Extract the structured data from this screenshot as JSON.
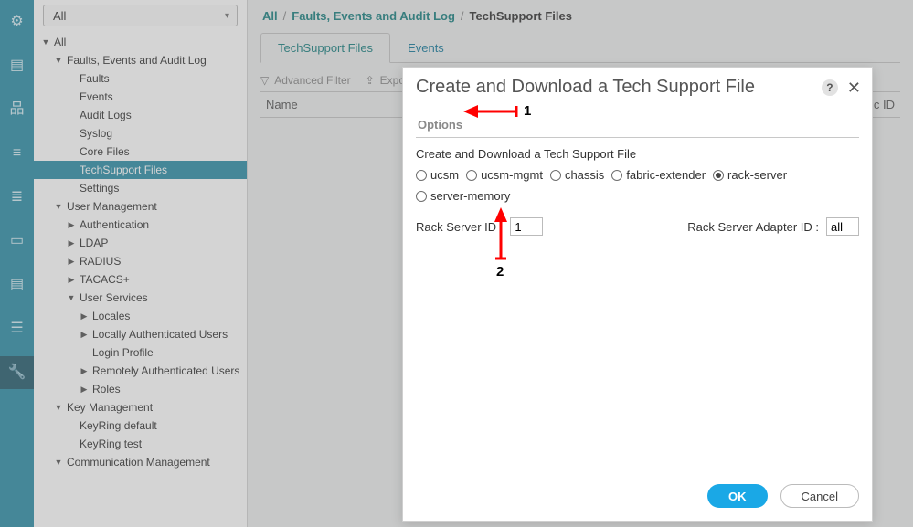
{
  "rail": {
    "items": [
      "network",
      "server",
      "topology",
      "stack",
      "rack",
      "monitor",
      "bars",
      "layers",
      "settings"
    ],
    "selected_index": 8
  },
  "nav": {
    "dropdown_value": "All",
    "tree": [
      {
        "lvl": 0,
        "label": "All",
        "arrow": "expanded"
      },
      {
        "lvl": 1,
        "label": "Faults, Events and Audit Log",
        "arrow": "expanded"
      },
      {
        "lvl": 2,
        "label": "Faults",
        "arrow": "none"
      },
      {
        "lvl": 2,
        "label": "Events",
        "arrow": "none"
      },
      {
        "lvl": 2,
        "label": "Audit Logs",
        "arrow": "none"
      },
      {
        "lvl": 2,
        "label": "Syslog",
        "arrow": "none"
      },
      {
        "lvl": 2,
        "label": "Core Files",
        "arrow": "none"
      },
      {
        "lvl": 2,
        "label": "TechSupport Files",
        "arrow": "none",
        "selected": true
      },
      {
        "lvl": 2,
        "label": "Settings",
        "arrow": "none"
      },
      {
        "lvl": 1,
        "label": "User Management",
        "arrow": "expanded"
      },
      {
        "lvl": 2,
        "label": "Authentication",
        "arrow": "collapsed"
      },
      {
        "lvl": 2,
        "label": "LDAP",
        "arrow": "collapsed"
      },
      {
        "lvl": 2,
        "label": "RADIUS",
        "arrow": "collapsed"
      },
      {
        "lvl": 2,
        "label": "TACACS+",
        "arrow": "collapsed"
      },
      {
        "lvl": 2,
        "label": "User Services",
        "arrow": "expanded"
      },
      {
        "lvl": 3,
        "label": "Locales",
        "arrow": "collapsed"
      },
      {
        "lvl": 3,
        "label": "Locally Authenticated Users",
        "arrow": "collapsed"
      },
      {
        "lvl": 3,
        "label": "Login Profile",
        "arrow": "none"
      },
      {
        "lvl": 3,
        "label": "Remotely Authenticated Users",
        "arrow": "collapsed"
      },
      {
        "lvl": 3,
        "label": "Roles",
        "arrow": "collapsed"
      },
      {
        "lvl": 1,
        "label": "Key Management",
        "arrow": "expanded"
      },
      {
        "lvl": 2,
        "label": "KeyRing default",
        "arrow": "none"
      },
      {
        "lvl": 2,
        "label": "KeyRing test",
        "arrow": "none"
      },
      {
        "lvl": 1,
        "label": "Communication Management",
        "arrow": "expanded"
      }
    ]
  },
  "breadcrumb": [
    {
      "label": "All"
    },
    {
      "label": "Faults, Events and Audit Log"
    },
    {
      "label": "TechSupport Files",
      "current": true
    }
  ],
  "tabs": [
    {
      "label": "TechSupport Files",
      "active": true
    },
    {
      "label": "Events",
      "active": false
    }
  ],
  "toolbar": {
    "filter_label": "Advanced Filter",
    "export_label": "Export"
  },
  "columns": {
    "name": "Name",
    "right": "ric ID"
  },
  "modal": {
    "title": "Create and Download a Tech Support File",
    "options_label": "Options",
    "subtitle": "Create and Download a Tech Support File",
    "radios": [
      {
        "label": "ucsm",
        "value": "ucsm",
        "checked": false
      },
      {
        "label": "ucsm-mgmt",
        "value": "ucsm-mgmt",
        "checked": false
      },
      {
        "label": "chassis",
        "value": "chassis",
        "checked": false
      },
      {
        "label": "fabric-extender",
        "value": "fabric-extender",
        "checked": false
      },
      {
        "label": "rack-server",
        "value": "rack-server",
        "checked": true
      },
      {
        "label": "server-memory",
        "value": "server-memory",
        "checked": false
      }
    ],
    "rack_server_id_label": "Rack Server ID :",
    "rack_server_id_value": "1",
    "rack_adapter_id_label": "Rack Server Adapter ID :",
    "rack_adapter_id_value": "all",
    "ok_label": "OK",
    "cancel_label": "Cancel"
  },
  "annotations": {
    "one": "1",
    "two": "2"
  }
}
